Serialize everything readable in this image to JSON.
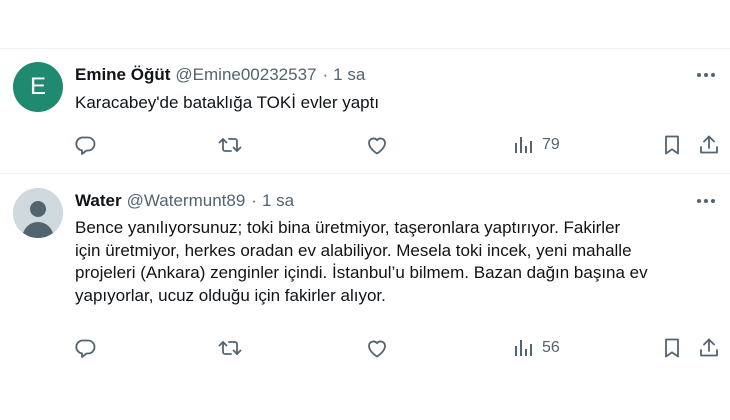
{
  "tweets": [
    {
      "avatar_letter": "E",
      "avatar_color": "#1f8a70",
      "name": "Emine Öğüt",
      "handle": "@Emine00232537",
      "separator": "·",
      "time": "1 sa",
      "text": "Karacabey'de bataklığa TOKİ evler yaptı",
      "views": "79",
      "icons": [
        "reply-icon",
        "retweet-icon",
        "like-icon",
        "views-icon",
        "bookmark-icon",
        "share-icon",
        "more-icon"
      ]
    },
    {
      "avatar_letter": "",
      "avatar_color": "#cfd9de",
      "name": "Water",
      "handle": "@Watermunt89",
      "separator": "·",
      "time": "1 sa",
      "text_lines": [
        "Bence yanılıyorsunuz; toki bina üretmiyor, taşeronlara yaptırıyor. Fakirler",
        "için üretmiyor, herkes oradan ev alabiliyor. Mesela toki incek, yeni mahalle",
        "projeleri (Ankara) zenginler içindi. İstanbul’u bilmem. Bazan dağın başına ev",
        "yapıyorlar, ucuz olduğu için fakirler alıyor."
      ],
      "views": "56",
      "icons": [
        "reply-icon",
        "retweet-icon",
        "like-icon",
        "views-icon",
        "bookmark-icon",
        "share-icon",
        "more-icon"
      ]
    }
  ]
}
